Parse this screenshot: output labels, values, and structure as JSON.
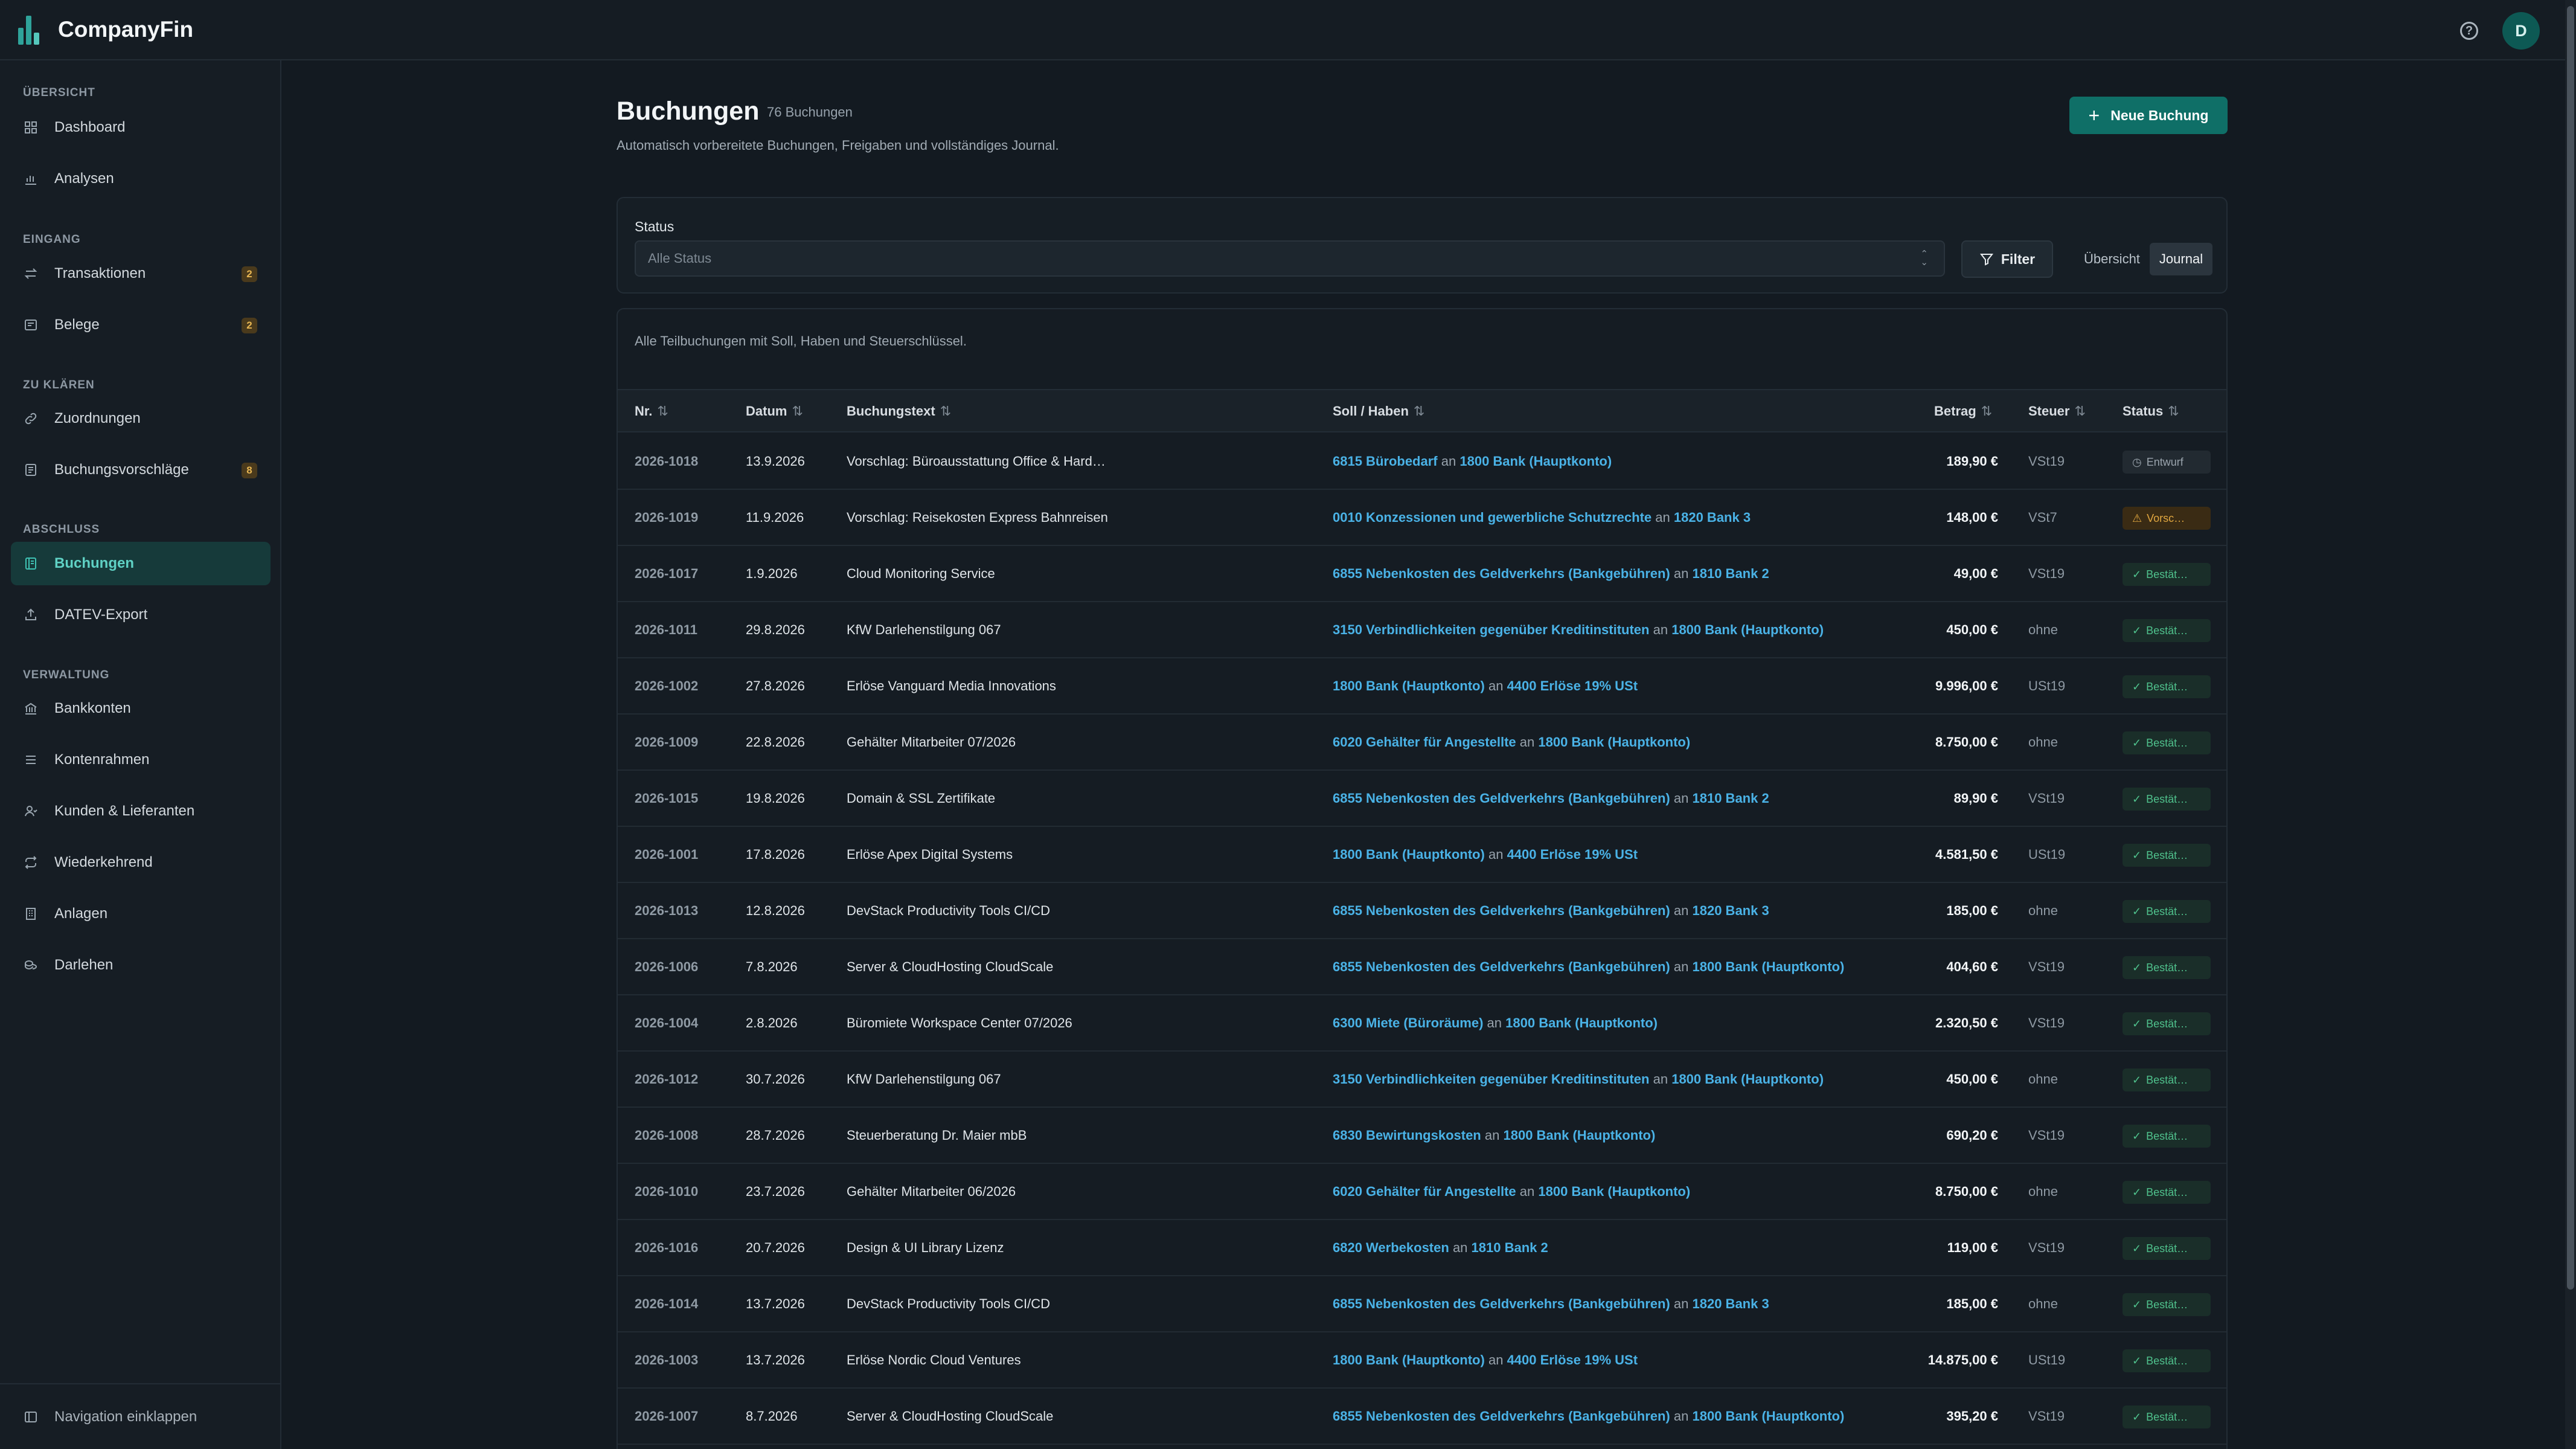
{
  "app": {
    "name": "CompanyFin",
    "avatar_initial": "D",
    "accent": "#0f6f67"
  },
  "sidebar": {
    "sections": [
      {
        "title": "ÜBERSICHT",
        "items": [
          {
            "label": "Dashboard",
            "icon": "grid-icon"
          },
          {
            "label": "Analysen",
            "icon": "bar-chart-icon"
          }
        ]
      },
      {
        "title": "EINGANG",
        "items": [
          {
            "label": "Transaktionen",
            "icon": "arrows-swap-icon",
            "badge": "2"
          },
          {
            "label": "Belege",
            "icon": "receipt-icon",
            "badge": "2"
          }
        ]
      },
      {
        "title": "ZU KLÄREN",
        "items": [
          {
            "label": "Zuordnungen",
            "icon": "link-icon"
          },
          {
            "label": "Buchungsvorschläge",
            "icon": "suggestion-icon",
            "badge": "8"
          }
        ]
      },
      {
        "title": "ABSCHLUSS",
        "items": [
          {
            "label": "Buchungen",
            "icon": "ledger-icon",
            "active": true
          },
          {
            "label": "DATEV-Export",
            "icon": "export-icon"
          }
        ]
      },
      {
        "title": "VERWALTUNG",
        "items": [
          {
            "label": "Bankkonten",
            "icon": "bank-icon"
          },
          {
            "label": "Kontenrahmen",
            "icon": "list-icon"
          },
          {
            "label": "Kunden & Lieferanten",
            "icon": "user-icon"
          },
          {
            "label": "Wiederkehrend",
            "icon": "repeat-icon"
          },
          {
            "label": "Anlagen",
            "icon": "building-icon"
          },
          {
            "label": "Darlehen",
            "icon": "coins-icon"
          }
        ]
      }
    ],
    "collapse_label": "Navigation einklappen"
  },
  "page": {
    "title": "Buchungen",
    "count": "76 Buchungen",
    "description": "Automatisch vorbereitete Buchungen, Freigaben und vollständiges Journal.",
    "new_button": "Neue Buchung"
  },
  "filter": {
    "status_label": "Status",
    "status_placeholder": "Alle Status",
    "filter_button": "Filter",
    "views": [
      "Übersicht",
      "Journal"
    ],
    "selected_view": "Journal"
  },
  "table": {
    "description": "Alle Teilbuchungen mit Soll, Haben und Steuerschlüssel.",
    "columns": [
      "Nr.",
      "Datum",
      "Buchungstext",
      "Soll / Haben",
      "Betrag",
      "Steuer",
      "Status"
    ],
    "connector": "an",
    "rows": [
      {
        "nr": "2026-1018",
        "date": "13.9.2026",
        "text": "Vorschlag: Büroausstattung Office & Hard…",
        "soll": "6815 Bürobedarf",
        "haben": "1800 Bank (Hauptkonto)",
        "amount": "189,90 €",
        "tax": "VSt19",
        "status": "Entwurf",
        "status_type": "draft"
      },
      {
        "nr": "2026-1019",
        "date": "11.9.2026",
        "text": "Vorschlag: Reisekosten Express Bahnreisen",
        "soll": "0010 Konzessionen und gewerbliche Schutzrechte",
        "haben": "1820 Bank 3",
        "amount": "148,00 €",
        "tax": "VSt7",
        "status": "Vorsc…",
        "status_type": "warn"
      },
      {
        "nr": "2026-1017",
        "date": "1.9.2026",
        "text": "Cloud Monitoring Service",
        "soll": "6855 Nebenkosten des Geldverkehrs (Bankgebühren)",
        "haben": "1810 Bank 2",
        "amount": "49,00 €",
        "tax": "VSt19",
        "status": "Bestät…",
        "status_type": "ok"
      },
      {
        "nr": "2026-1011",
        "date": "29.8.2026",
        "text": "KfW Darlehenstilgung 067",
        "soll": "3150 Verbindlichkeiten gegenüber Kreditinstituten",
        "haben": "1800 Bank (Hauptkonto)",
        "amount": "450,00 €",
        "tax": "ohne",
        "status": "Bestät…",
        "status_type": "ok"
      },
      {
        "nr": "2026-1002",
        "date": "27.8.2026",
        "text": "Erlöse Vanguard Media Innovations",
        "soll": "1800 Bank (Hauptkonto)",
        "haben": "4400 Erlöse 19% USt",
        "amount": "9.996,00 €",
        "tax": "USt19",
        "status": "Bestät…",
        "status_type": "ok"
      },
      {
        "nr": "2026-1009",
        "date": "22.8.2026",
        "text": "Gehälter Mitarbeiter 07/2026",
        "soll": "6020 Gehälter für Angestellte",
        "haben": "1800 Bank (Hauptkonto)",
        "amount": "8.750,00 €",
        "tax": "ohne",
        "status": "Bestät…",
        "status_type": "ok"
      },
      {
        "nr": "2026-1015",
        "date": "19.8.2026",
        "text": "Domain & SSL Zertifikate",
        "soll": "6855 Nebenkosten des Geldverkehrs (Bankgebühren)",
        "haben": "1810 Bank 2",
        "amount": "89,90 €",
        "tax": "VSt19",
        "status": "Bestät…",
        "status_type": "ok"
      },
      {
        "nr": "2026-1001",
        "date": "17.8.2026",
        "text": "Erlöse Apex Digital Systems",
        "soll": "1800 Bank (Hauptkonto)",
        "haben": "4400 Erlöse 19% USt",
        "amount": "4.581,50 €",
        "tax": "USt19",
        "status": "Bestät…",
        "status_type": "ok"
      },
      {
        "nr": "2026-1013",
        "date": "12.8.2026",
        "text": "DevStack Productivity Tools CI/CD",
        "soll": "6855 Nebenkosten des Geldverkehrs (Bankgebühren)",
        "haben": "1820 Bank 3",
        "amount": "185,00 €",
        "tax": "ohne",
        "status": "Bestät…",
        "status_type": "ok"
      },
      {
        "nr": "2026-1006",
        "date": "7.8.2026",
        "text": "Server & CloudHosting CloudScale",
        "soll": "6855 Nebenkosten des Geldverkehrs (Bankgebühren)",
        "haben": "1800 Bank (Hauptkonto)",
        "amount": "404,60 €",
        "tax": "VSt19",
        "status": "Bestät…",
        "status_type": "ok"
      },
      {
        "nr": "2026-1004",
        "date": "2.8.2026",
        "text": "Büromiete Workspace Center 07/2026",
        "soll": "6300 Miete (Büroräume)",
        "haben": "1800 Bank (Hauptkonto)",
        "amount": "2.320,50 €",
        "tax": "VSt19",
        "status": "Bestät…",
        "status_type": "ok"
      },
      {
        "nr": "2026-1012",
        "date": "30.7.2026",
        "text": "KfW Darlehenstilgung 067",
        "soll": "3150 Verbindlichkeiten gegenüber Kreditinstituten",
        "haben": "1800 Bank (Hauptkonto)",
        "amount": "450,00 €",
        "tax": "ohne",
        "status": "Bestät…",
        "status_type": "ok"
      },
      {
        "nr": "2026-1008",
        "date": "28.7.2026",
        "text": "Steuerberatung Dr. Maier mbB",
        "soll": "6830 Bewirtungskosten",
        "haben": "1800 Bank (Hauptkonto)",
        "amount": "690,20 €",
        "tax": "VSt19",
        "status": "Bestät…",
        "status_type": "ok"
      },
      {
        "nr": "2026-1010",
        "date": "23.7.2026",
        "text": "Gehälter Mitarbeiter 06/2026",
        "soll": "6020 Gehälter für Angestellte",
        "haben": "1800 Bank (Hauptkonto)",
        "amount": "8.750,00 €",
        "tax": "ohne",
        "status": "Bestät…",
        "status_type": "ok"
      },
      {
        "nr": "2026-1016",
        "date": "20.7.2026",
        "text": "Design & UI Library Lizenz",
        "soll": "6820 Werbekosten",
        "haben": "1810 Bank 2",
        "amount": "119,00 €",
        "tax": "VSt19",
        "status": "Bestät…",
        "status_type": "ok"
      },
      {
        "nr": "2026-1014",
        "date": "13.7.2026",
        "text": "DevStack Productivity Tools CI/CD",
        "soll": "6855 Nebenkosten des Geldverkehrs (Bankgebühren)",
        "haben": "1820 Bank 3",
        "amount": "185,00 €",
        "tax": "ohne",
        "status": "Bestät…",
        "status_type": "ok"
      },
      {
        "nr": "2026-1003",
        "date": "13.7.2026",
        "text": "Erlöse Nordic Cloud Ventures",
        "soll": "1800 Bank (Hauptkonto)",
        "haben": "4400 Erlöse 19% USt",
        "amount": "14.875,00 €",
        "tax": "USt19",
        "status": "Bestät…",
        "status_type": "ok"
      },
      {
        "nr": "2026-1007",
        "date": "8.7.2026",
        "text": "Server & CloudHosting CloudScale",
        "soll": "6855 Nebenkosten des Geldverkehrs (Bankgebühren)",
        "haben": "1800 Bank (Hauptkonto)",
        "amount": "395,20 €",
        "tax": "VSt19",
        "status": "Bestät…",
        "status_type": "ok"
      }
    ]
  }
}
